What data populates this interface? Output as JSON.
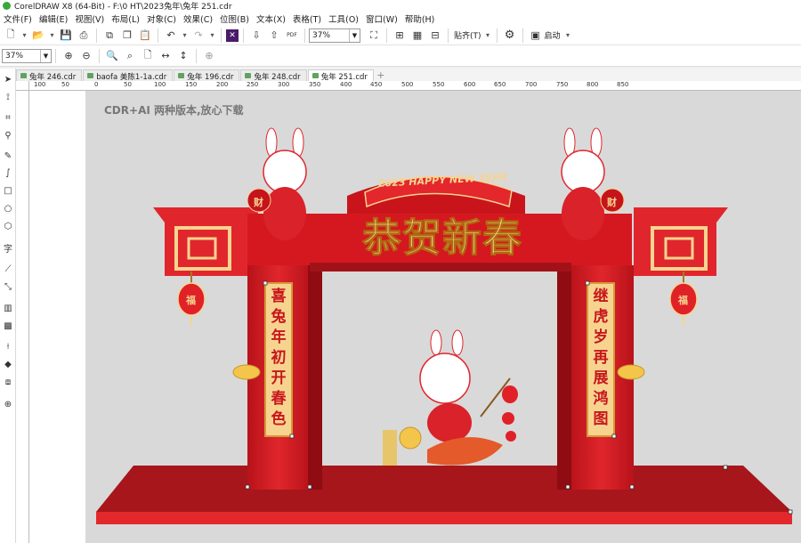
{
  "window": {
    "title": "CorelDRAW X8 (64-Bit) - F:\\0 HT\\2023兔年\\兔年 251.cdr"
  },
  "menu": [
    "文件(F)",
    "编辑(E)",
    "视图(V)",
    "布局(L)",
    "对象(C)",
    "效果(C)",
    "位图(B)",
    "文本(X)",
    "表格(T)",
    "工具(O)",
    "窗口(W)",
    "帮助(H)"
  ],
  "toolbar": {
    "zoom_value": "37%",
    "snap_label": "贴齐(T)",
    "launch_label": "启动"
  },
  "propbar": {
    "zoom_value": "37%"
  },
  "tabs": [
    {
      "label": "兔年 246.cdr",
      "active": false
    },
    {
      "label": "baofa 美陈1-1a.cdr",
      "active": false
    },
    {
      "label": "兔年 196.cdr",
      "active": false
    },
    {
      "label": "兔年 248.cdr",
      "active": false
    },
    {
      "label": "兔年 251.cdr",
      "active": true
    }
  ],
  "ruler": {
    "h_ticks": [
      "100",
      "50",
      "0",
      "50",
      "100",
      "150",
      "200",
      "250",
      "300",
      "350",
      "400",
      "450",
      "500",
      "550",
      "600",
      "650",
      "700",
      "750",
      "800",
      "850"
    ]
  },
  "canvas": {
    "watermark": "CDR+AI 两种版本,放心下载",
    "banner_text": "2023 HAPPY NEW YEAR",
    "headline": "恭贺新春",
    "left_couplet": "喜兔年初开春色",
    "right_couplet": "继虎岁再展鸿图",
    "lantern_char": "福",
    "coin_char": "财"
  },
  "colors": {
    "brand_red": "#d0171f",
    "dark_red": "#9a0d14",
    "gold": "#f6d48f",
    "floor": "#c71f23"
  }
}
